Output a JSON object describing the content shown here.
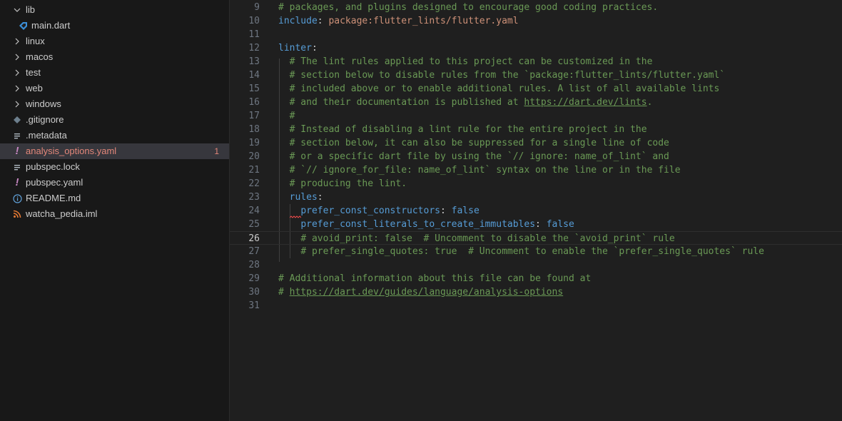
{
  "explorer": {
    "items": [
      {
        "label": "lib",
        "icon": "chevron-down-icon",
        "type": "folder-open"
      },
      {
        "label": "main.dart",
        "icon": "dart-icon",
        "type": "file"
      },
      {
        "label": "linux",
        "icon": "chevron-right-icon",
        "type": "folder"
      },
      {
        "label": "macos",
        "icon": "chevron-right-icon",
        "type": "folder"
      },
      {
        "label": "test",
        "icon": "chevron-right-icon",
        "type": "folder"
      },
      {
        "label": "web",
        "icon": "chevron-right-icon",
        "type": "folder"
      },
      {
        "label": "windows",
        "icon": "chevron-right-icon",
        "type": "folder"
      },
      {
        "label": ".gitignore",
        "icon": "git-icon",
        "type": "file"
      },
      {
        "label": ".metadata",
        "icon": "lines-icon",
        "type": "file"
      },
      {
        "label": "analysis_options.yaml",
        "icon": "yaml-warning-icon",
        "type": "file",
        "badge": "1",
        "selected": true
      },
      {
        "label": "pubspec.lock",
        "icon": "lines-icon",
        "type": "file"
      },
      {
        "label": "pubspec.yaml",
        "icon": "yaml-icon",
        "type": "file"
      },
      {
        "label": "README.md",
        "icon": "info-icon",
        "type": "file"
      },
      {
        "label": "watcha_pedia.iml",
        "icon": "rss-icon",
        "type": "file"
      }
    ]
  },
  "editor": {
    "active_line": "26",
    "lines": [
      {
        "n": "9",
        "text": "# packages, and plugins designed to encourage good coding practices."
      },
      {
        "n": "10",
        "text": "include: package:flutter_lints/flutter.yaml"
      },
      {
        "n": "11",
        "text": ""
      },
      {
        "n": "12",
        "text": "linter:"
      },
      {
        "n": "13",
        "text": "  # The lint rules applied to this project can be customized in the"
      },
      {
        "n": "14",
        "text": "  # section below to disable rules from the `package:flutter_lints/flutter.yaml`"
      },
      {
        "n": "15",
        "text": "  # included above or to enable additional rules. A list of all available lints"
      },
      {
        "n": "16",
        "text": "  # and their documentation is published at https://dart.dev/lints."
      },
      {
        "n": "17",
        "text": "  #"
      },
      {
        "n": "18",
        "text": "  # Instead of disabling a lint rule for the entire project in the"
      },
      {
        "n": "19",
        "text": "  # section below, it can also be suppressed for a single line of code"
      },
      {
        "n": "20",
        "text": "  # or a specific dart file by using the `// ignore: name_of_lint` and"
      },
      {
        "n": "21",
        "text": "  # `// ignore_for_file: name_of_lint` syntax on the line or in the file"
      },
      {
        "n": "22",
        "text": "  # producing the lint."
      },
      {
        "n": "23",
        "text": "  rules:"
      },
      {
        "n": "24",
        "text": "    prefer_const_constructors: false"
      },
      {
        "n": "25",
        "text": "    prefer_const_literals_to_create_immutables: false"
      },
      {
        "n": "26",
        "text": "    # avoid_print: false  # Uncomment to disable the `avoid_print` rule"
      },
      {
        "n": "27",
        "text": "    # prefer_single_quotes: true  # Uncomment to enable the `prefer_single_quotes` rule"
      },
      {
        "n": "28",
        "text": ""
      },
      {
        "n": "29",
        "text": "# Additional information about this file can be found at"
      },
      {
        "n": "30",
        "text": "# https://dart.dev/guides/language/analysis-options"
      },
      {
        "n": "31",
        "text": ""
      }
    ]
  },
  "colors": {
    "comment": "#6a9955",
    "key": "#569cd6",
    "string": "#ce9178",
    "warning": "#e3877a",
    "error_squiggle": "#f14c4c"
  }
}
